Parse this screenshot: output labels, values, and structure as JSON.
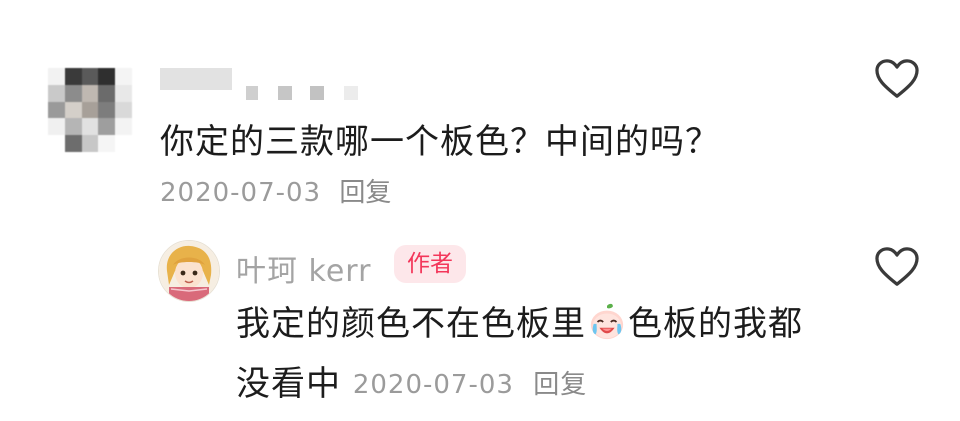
{
  "comments": [
    {
      "text": "你定的三款哪一个板色？中间的吗？",
      "date": "2020-07-03",
      "reply_label": "回复"
    }
  ],
  "reply": {
    "username": "叶珂 kerr",
    "badge": "作者",
    "text_part1": "我定的颜色不在色板里",
    "text_part2": "色板的我都",
    "text_line2": "没看中",
    "date": "2020-07-03",
    "reply_label": "回复",
    "emoji": "crying-laughing-emoji"
  },
  "colors": {
    "text_primary": "#1c1c1c",
    "text_meta": "#9b9b9b",
    "badge_bg": "#fde7ea",
    "badge_text": "#f3365a",
    "icon_stroke": "#3a3a3a"
  },
  "icons": {
    "like": "heart-outline-icon"
  }
}
